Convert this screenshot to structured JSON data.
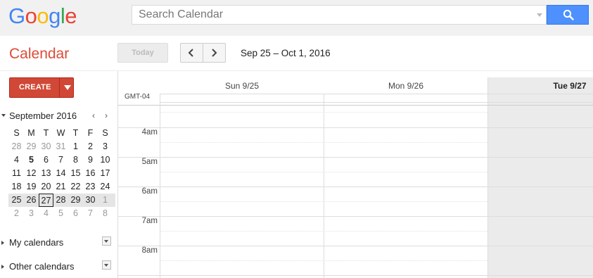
{
  "header": {
    "logo_letters": [
      {
        "ch": "G",
        "color": "#4285f4"
      },
      {
        "ch": "o",
        "color": "#ea4335"
      },
      {
        "ch": "o",
        "color": "#fbbc05"
      },
      {
        "ch": "g",
        "color": "#4285f4"
      },
      {
        "ch": "l",
        "color": "#34a853"
      },
      {
        "ch": "e",
        "color": "#ea4335"
      }
    ],
    "search_placeholder": "Search Calendar",
    "search_value": ""
  },
  "toolbar": {
    "app_title": "Calendar",
    "today_label": "Today",
    "date_range": "Sep 25 – Oct 1, 2016"
  },
  "sidebar": {
    "create_label": "CREATE",
    "mini_calendar": {
      "month_title": "September 2016",
      "weekdays": [
        "S",
        "M",
        "T",
        "W",
        "T",
        "F",
        "S"
      ],
      "weeks": [
        [
          {
            "d": "28",
            "other": true
          },
          {
            "d": "29",
            "other": true
          },
          {
            "d": "30",
            "other": true
          },
          {
            "d": "31",
            "other": true
          },
          {
            "d": "1"
          },
          {
            "d": "2"
          },
          {
            "d": "3"
          }
        ],
        [
          {
            "d": "4"
          },
          {
            "d": "5",
            "bold": true
          },
          {
            "d": "6"
          },
          {
            "d": "7"
          },
          {
            "d": "8"
          },
          {
            "d": "9"
          },
          {
            "d": "10"
          }
        ],
        [
          {
            "d": "11"
          },
          {
            "d": "12"
          },
          {
            "d": "13"
          },
          {
            "d": "14"
          },
          {
            "d": "15"
          },
          {
            "d": "16"
          },
          {
            "d": "17"
          }
        ],
        [
          {
            "d": "18"
          },
          {
            "d": "19"
          },
          {
            "d": "20"
          },
          {
            "d": "21"
          },
          {
            "d": "22"
          },
          {
            "d": "23"
          },
          {
            "d": "24"
          }
        ],
        [
          {
            "d": "25"
          },
          {
            "d": "26"
          },
          {
            "d": "27",
            "today": true
          },
          {
            "d": "28"
          },
          {
            "d": "29"
          },
          {
            "d": "30"
          },
          {
            "d": "1",
            "other": true
          }
        ],
        [
          {
            "d": "2",
            "other": true
          },
          {
            "d": "3",
            "other": true
          },
          {
            "d": "4",
            "other": true
          },
          {
            "d": "5",
            "other": true
          },
          {
            "d": "6",
            "other": true
          },
          {
            "d": "7",
            "other": true
          },
          {
            "d": "8",
            "other": true
          }
        ]
      ],
      "highlighted_week": 4
    },
    "sections": [
      {
        "label": "My calendars"
      },
      {
        "label": "Other calendars"
      }
    ]
  },
  "grid": {
    "timezone": "GMT-04",
    "days": [
      {
        "label": "Sun 9/25",
        "bold": false
      },
      {
        "label": "Mon 9/26",
        "bold": false
      },
      {
        "label": "Tue 9/27",
        "bold": true
      }
    ],
    "hours": [
      "4am",
      "5am",
      "6am",
      "7am",
      "8am"
    ]
  }
}
